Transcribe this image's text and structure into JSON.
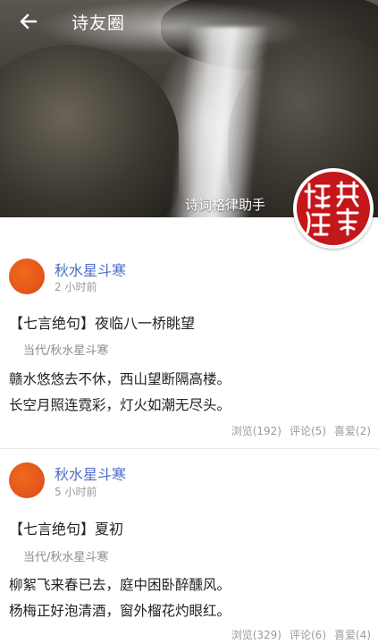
{
  "header": {
    "title": "诗友圈",
    "brand_text": "诗词格律助手",
    "seal_text": "格律诗词"
  },
  "posts": [
    {
      "author": "秋水星斗寒",
      "time": "2 小时前",
      "title": "【七言绝句】夜临八一桥眺望",
      "dynasty": "当代/秋水星斗寒",
      "lines": [
        "赣水悠悠去不休，西山望断隔高楼。",
        "长空月照连霓彩，灯火如潮无尽头。"
      ],
      "views": "浏览(192)",
      "comments": "评论(5)",
      "likes": "喜爱(2)"
    },
    {
      "author": "秋水星斗寒",
      "time": "5 小时前",
      "title": "【七言绝句】夏初",
      "dynasty": "当代/秋水星斗寒",
      "lines": [
        "柳絮飞来春已去，庭中困卧醉醺风。",
        "杨梅正好泡清酒，窗外榴花灼眼红。"
      ],
      "views": "浏览(329)",
      "comments": "评论(6)",
      "likes": "喜爱(4)"
    }
  ],
  "colors": {
    "author": "#4d6bc9",
    "avatar": "#e2541a",
    "seal": "#c4171b"
  },
  "icons": {
    "back": "arrow-left-icon",
    "avatar": "avatar"
  }
}
